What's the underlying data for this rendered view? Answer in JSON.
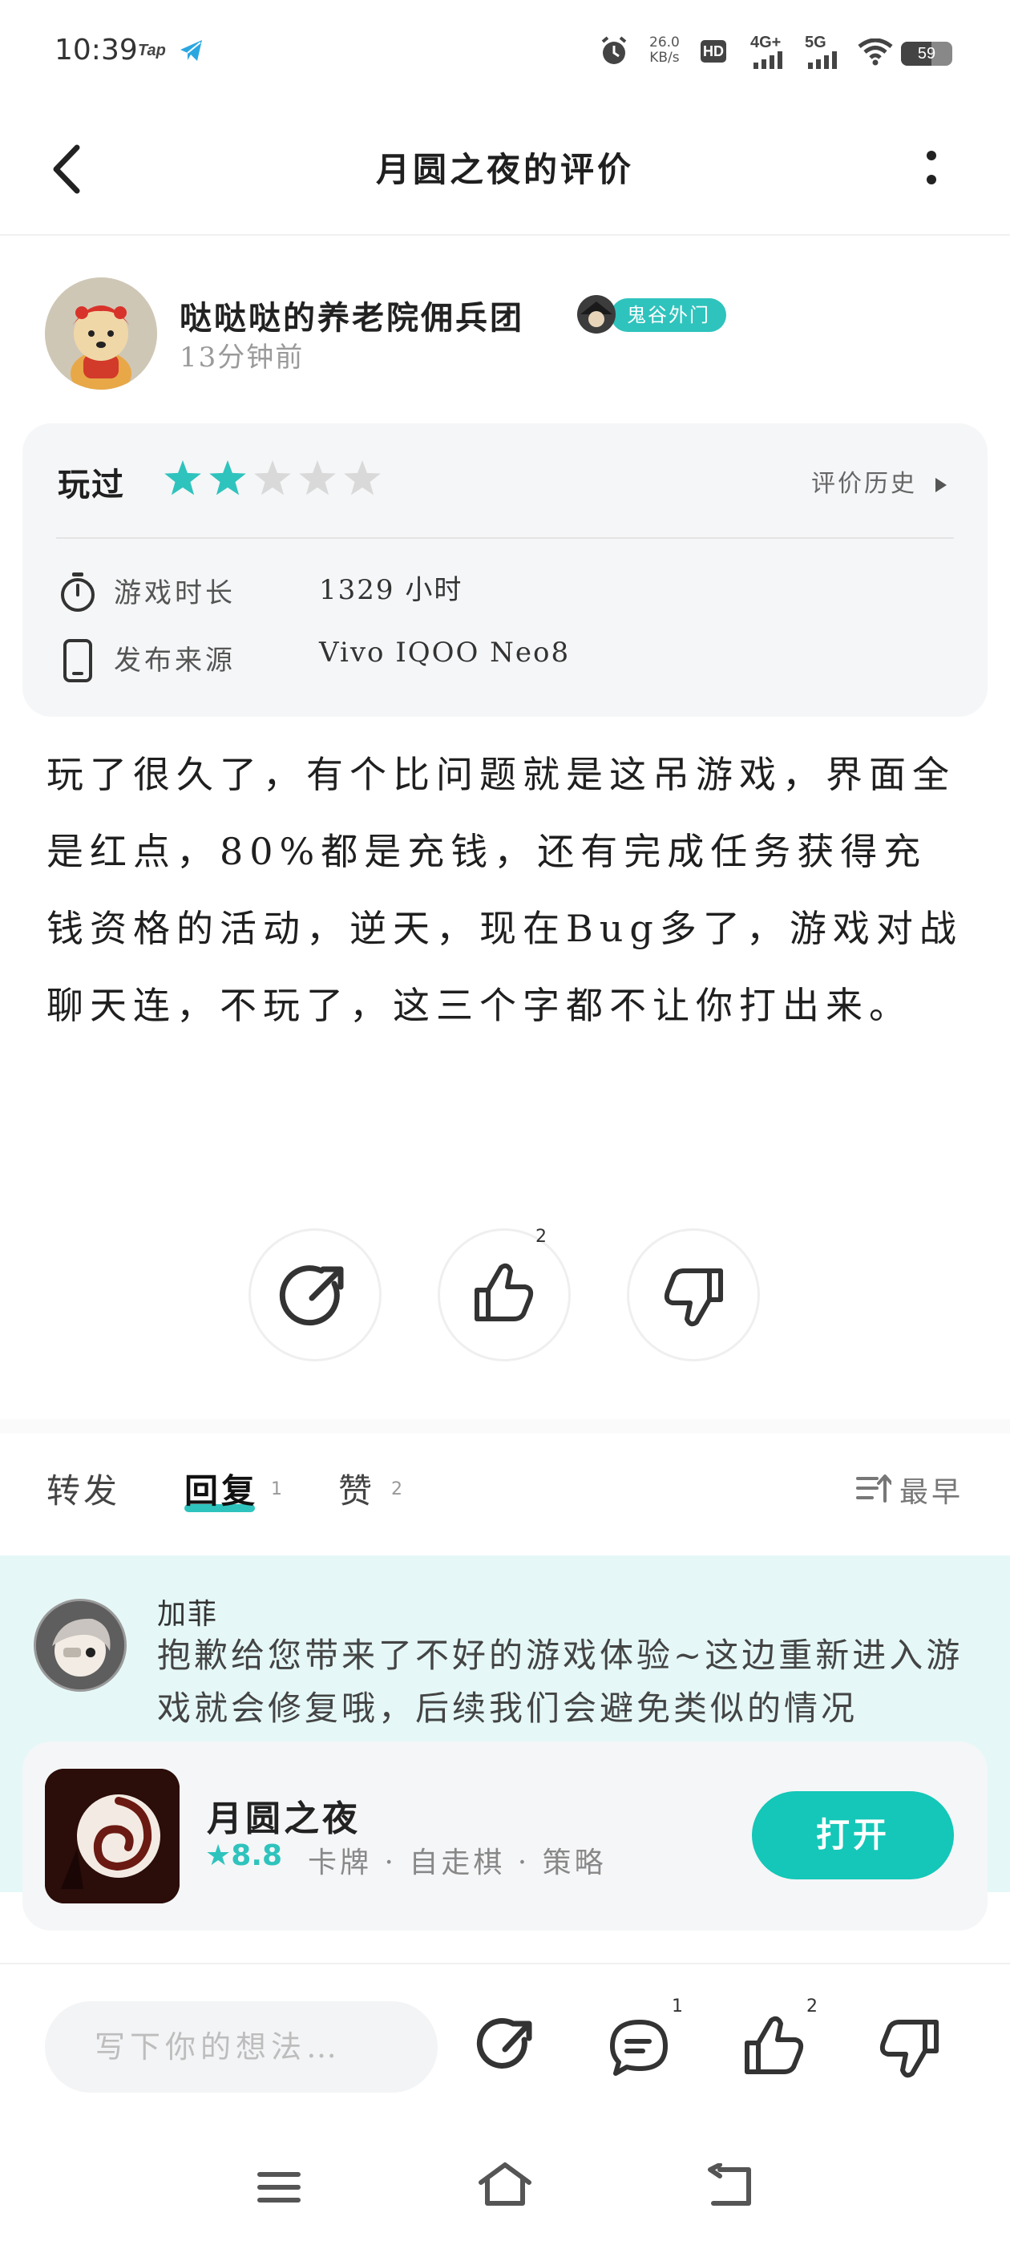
{
  "status_bar": {
    "time": "10:39",
    "tap_label": "Tap",
    "net_speed_value": "26.0",
    "net_speed_unit": "KB/s",
    "hd_label": "HD",
    "lte_label": "4G+",
    "fiveg_label": "5G",
    "battery": "59"
  },
  "nav": {
    "title": "月圆之夜的评价"
  },
  "author": {
    "name": "哒哒哒的养老院佣兵团",
    "badge": "鬼谷外门",
    "posted": "13分钟前"
  },
  "rating_card": {
    "status_label": "玩过",
    "stars_filled": 2,
    "stars_total": 5,
    "history_label": "评价历史",
    "rows": [
      {
        "icon": "stopwatch-icon",
        "label": "游戏时长",
        "value": "1329 小时"
      },
      {
        "icon": "phone-icon",
        "label": "发布来源",
        "value": "Vivo IQOO Neo8"
      }
    ]
  },
  "review": {
    "text": "玩了很久了，有个比问题就是这吊游戏，界面全是红点，80%都是充钱，还有完成任务获得充钱资格的活动，逆天，现在Bug多了，游戏对战聊天连，不玩了，这三个字都不让你打出来。"
  },
  "actions": {
    "like_count": "2"
  },
  "tabs": {
    "forward": "转发",
    "reply": "回复",
    "reply_count": "1",
    "like": "赞",
    "like_count": "2",
    "sort": "最早"
  },
  "reply": {
    "name": "加菲",
    "text": "抱歉给您带来了不好的游戏体验~这边重新进入游戏就会修复哦，后续我们会避免类似的情况"
  },
  "game": {
    "name": "月圆之夜",
    "score": "8.8",
    "tags": "卡牌 · 自走棋 · 策略",
    "open_label": "打开"
  },
  "bottom_bar": {
    "placeholder": "写下你的想法…",
    "comment_count": "1",
    "like_count": "2"
  },
  "colors": {
    "accent": "#2fc3bd",
    "star_empty": "#d9d9d9",
    "reply_bg": "#e5f8f7"
  }
}
